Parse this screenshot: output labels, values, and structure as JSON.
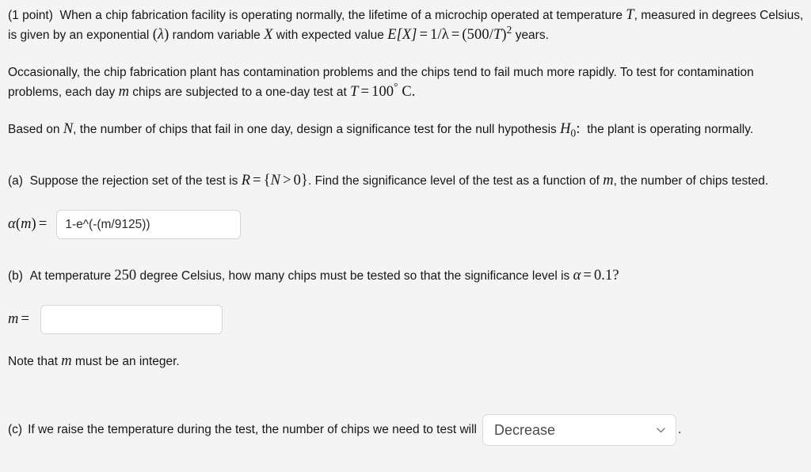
{
  "problem": {
    "points_label": "(1 point)",
    "paragraph1": {
      "before_T": "When a chip fabrication facility is operating normally, the lifetime of a microchip operated at temperature",
      "var_T": "T",
      "after_T": ", measured in degrees Celsius, is given by an exponential",
      "lambda": "λ",
      "mid": "random variable",
      "var_X": "X",
      "with_expected": "with expected value",
      "expected_expr_EX": "E[X]",
      "eq1": "=",
      "one_over_lambda": "1/λ",
      "eq2": "=",
      "paren_open": "(",
      "num_500": "500",
      "slash": "/",
      "var_T2": "T",
      "paren_close": ")",
      "exponent": "2",
      "years": "years."
    },
    "paragraph2": {
      "text_part1": "Occasionally, the chip fabrication plant has contamination problems and the chips tend to fail much more rapidly. To test for contamination problems, each day",
      "var_m": "m",
      "text_part2": "chips are subjected to a one-day test at",
      "var_T": "T",
      "eq": "=",
      "temp_value": "100",
      "degree": "°",
      "celsius": "C."
    },
    "paragraph3": {
      "text_part1": "Based on",
      "var_N": "N",
      "text_part2": ", the number of chips that fail in one day, design a significance test for the null hypothesis",
      "var_H": "H",
      "sub_0": "0",
      "colon": ":",
      "text_part3": "the plant is operating normally."
    }
  },
  "part_a": {
    "label": "(a)",
    "text_part1": "Suppose the rejection set of the test is",
    "var_R": "R",
    "eq": "=",
    "brace_open": "{",
    "var_N": "N",
    "gt": ">",
    "zero": "0",
    "brace_close": "}",
    "text_part2": ". Find the significance level of the test as a function of",
    "var_m": "m",
    "text_part3": ", the number of chips tested.",
    "answer": {
      "label_alpha": "α",
      "label_paren_open": "(",
      "label_m": "m",
      "label_paren_close": ")",
      "label_eq": "=",
      "value": "1-e^(-(m/9125))",
      "placeholder": ""
    }
  },
  "part_b": {
    "label": "(b)",
    "text_part1": "At temperature",
    "temp_value": "250",
    "text_part2": "degree Celsius, how many chips must be tested so that the significance level is",
    "var_alpha": "α",
    "eq": "=",
    "alpha_value": "0.1?",
    "answer": {
      "label_m": "m",
      "label_eq": "=",
      "value": "",
      "placeholder": ""
    },
    "note": {
      "text_part1": "Note that",
      "var_m": "m",
      "text_part2": "must be an integer."
    }
  },
  "part_c": {
    "label": "(c)",
    "text": "If we raise the temperature during the test, the number of chips we need to test will",
    "dropdown": {
      "selected": "Decrease",
      "options": [
        "Decrease"
      ],
      "icon": "chevron-down-icon"
    },
    "trailing_period": "."
  },
  "colors": {
    "page_background": "#f4f4f4",
    "text": "#161616",
    "input_border": "#d6d6d6",
    "input_background": "#ffffff",
    "input_text": "#2b2b2b",
    "select_text": "#4a4a4a"
  }
}
